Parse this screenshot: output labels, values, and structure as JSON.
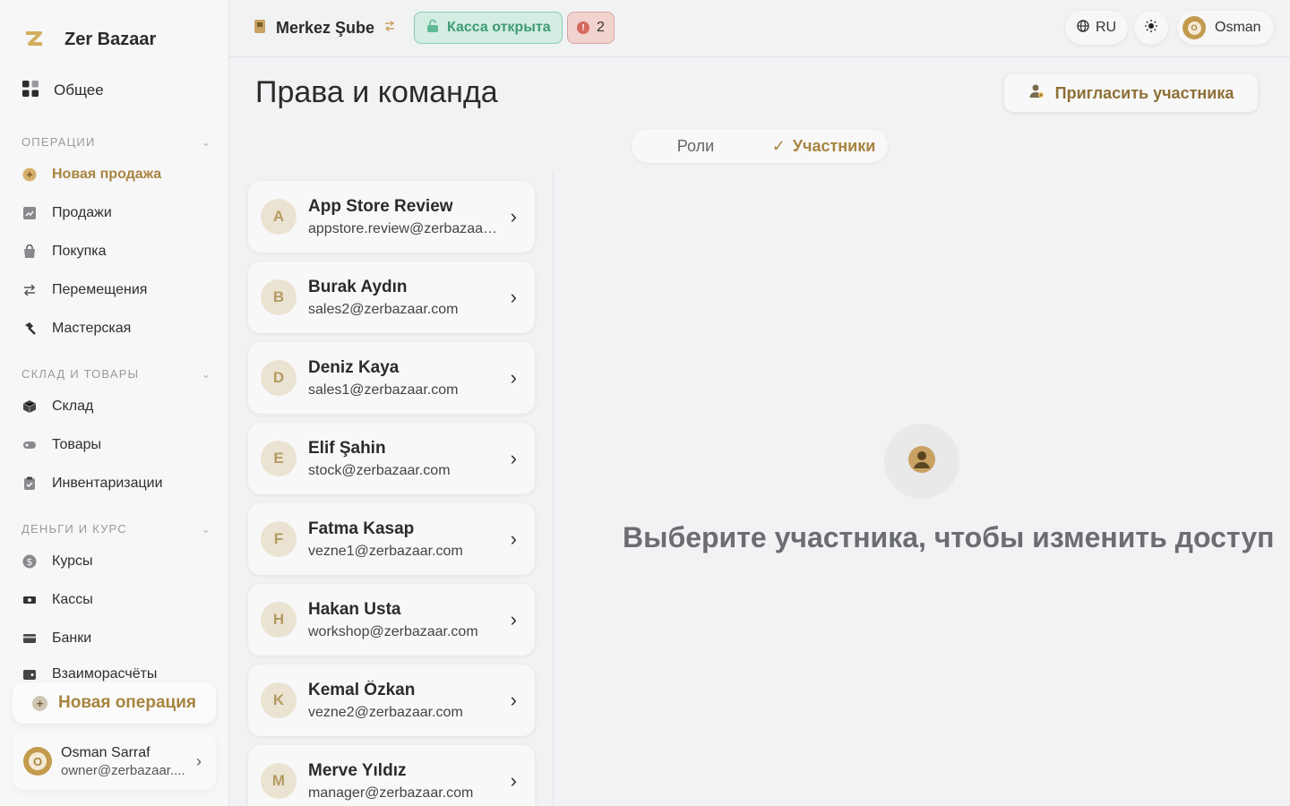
{
  "brand": {
    "name": "Zer Bazaar"
  },
  "nav": {
    "overview": "Общее",
    "sections": [
      {
        "title": "ОПЕРАЦИИ",
        "items": [
          "Новая продажа",
          "Продажи",
          "Покупка",
          "Перемещения",
          "Мастерская"
        ]
      },
      {
        "title": "СКЛАД И ТОВАРЫ",
        "items": [
          "Склад",
          "Товары",
          "Инвентаризации"
        ]
      },
      {
        "title": "ДЕНЬГИ И КУРС",
        "items": [
          "Курсы",
          "Кассы",
          "Банки",
          "Взаиморасчёты"
        ]
      }
    ],
    "new_operation": "Новая операция"
  },
  "user": {
    "name": "Osman Sarraf",
    "email": "owner@zerbazaar....",
    "avatar_letter": "O"
  },
  "topbar": {
    "branch": "Merkez Şube",
    "kassa_status": "Касса открыта",
    "alerts_count": "2",
    "lang": "RU",
    "profile_name": "Osman",
    "profile_letter": "O"
  },
  "page": {
    "title": "Права и команда",
    "invite_button": "Пригласить участника",
    "tabs": [
      "Роли",
      "Участники"
    ],
    "active_tab": "Участники",
    "empty_state": "Выберите участника, чтобы изменить доступ"
  },
  "members": [
    {
      "letter": "A",
      "name": "App Store Review",
      "email": "appstore.review@zerbazaar.com"
    },
    {
      "letter": "B",
      "name": "Burak Aydın",
      "email": "sales2@zerbazaar.com"
    },
    {
      "letter": "D",
      "name": "Deniz Kaya",
      "email": "sales1@zerbazaar.com"
    },
    {
      "letter": "E",
      "name": "Elif Şahin",
      "email": "stock@zerbazaar.com"
    },
    {
      "letter": "F",
      "name": "Fatma Kasap",
      "email": "vezne1@zerbazaar.com"
    },
    {
      "letter": "H",
      "name": "Hakan Usta",
      "email": "workshop@zerbazaar.com"
    },
    {
      "letter": "K",
      "name": "Kemal Özkan",
      "email": "vezne2@zerbazaar.com"
    },
    {
      "letter": "M",
      "name": "Merve Yıldız",
      "email": "manager@zerbazaar.com"
    }
  ],
  "colors": {
    "accent": "#a7843f",
    "success": "#3f9b76",
    "danger": "#d46a5f"
  }
}
